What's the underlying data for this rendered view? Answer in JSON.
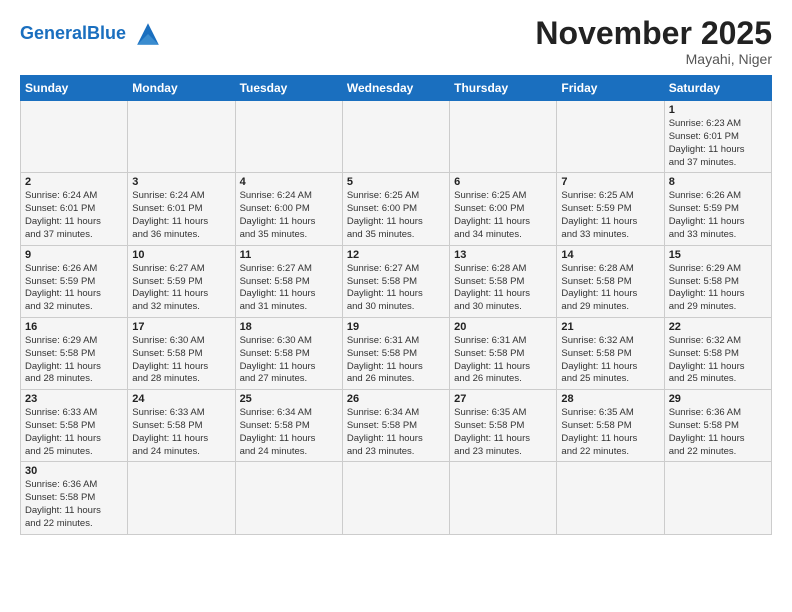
{
  "header": {
    "logo_general": "General",
    "logo_blue": "Blue",
    "month_title": "November 2025",
    "location": "Mayahi, Niger"
  },
  "weekdays": [
    "Sunday",
    "Monday",
    "Tuesday",
    "Wednesday",
    "Thursday",
    "Friday",
    "Saturday"
  ],
  "days": [
    {
      "num": "",
      "info": ""
    },
    {
      "num": "",
      "info": ""
    },
    {
      "num": "",
      "info": ""
    },
    {
      "num": "",
      "info": ""
    },
    {
      "num": "",
      "info": ""
    },
    {
      "num": "",
      "info": ""
    },
    {
      "num": "1",
      "info": "Sunrise: 6:23 AM\nSunset: 6:01 PM\nDaylight: 11 hours\nand 37 minutes."
    },
    {
      "num": "2",
      "info": "Sunrise: 6:24 AM\nSunset: 6:01 PM\nDaylight: 11 hours\nand 37 minutes."
    },
    {
      "num": "3",
      "info": "Sunrise: 6:24 AM\nSunset: 6:01 PM\nDaylight: 11 hours\nand 36 minutes."
    },
    {
      "num": "4",
      "info": "Sunrise: 6:24 AM\nSunset: 6:00 PM\nDaylight: 11 hours\nand 35 minutes."
    },
    {
      "num": "5",
      "info": "Sunrise: 6:25 AM\nSunset: 6:00 PM\nDaylight: 11 hours\nand 35 minutes."
    },
    {
      "num": "6",
      "info": "Sunrise: 6:25 AM\nSunset: 6:00 PM\nDaylight: 11 hours\nand 34 minutes."
    },
    {
      "num": "7",
      "info": "Sunrise: 6:25 AM\nSunset: 5:59 PM\nDaylight: 11 hours\nand 33 minutes."
    },
    {
      "num": "8",
      "info": "Sunrise: 6:26 AM\nSunset: 5:59 PM\nDaylight: 11 hours\nand 33 minutes."
    },
    {
      "num": "9",
      "info": "Sunrise: 6:26 AM\nSunset: 5:59 PM\nDaylight: 11 hours\nand 32 minutes."
    },
    {
      "num": "10",
      "info": "Sunrise: 6:27 AM\nSunset: 5:59 PM\nDaylight: 11 hours\nand 32 minutes."
    },
    {
      "num": "11",
      "info": "Sunrise: 6:27 AM\nSunset: 5:58 PM\nDaylight: 11 hours\nand 31 minutes."
    },
    {
      "num": "12",
      "info": "Sunrise: 6:27 AM\nSunset: 5:58 PM\nDaylight: 11 hours\nand 30 minutes."
    },
    {
      "num": "13",
      "info": "Sunrise: 6:28 AM\nSunset: 5:58 PM\nDaylight: 11 hours\nand 30 minutes."
    },
    {
      "num": "14",
      "info": "Sunrise: 6:28 AM\nSunset: 5:58 PM\nDaylight: 11 hours\nand 29 minutes."
    },
    {
      "num": "15",
      "info": "Sunrise: 6:29 AM\nSunset: 5:58 PM\nDaylight: 11 hours\nand 29 minutes."
    },
    {
      "num": "16",
      "info": "Sunrise: 6:29 AM\nSunset: 5:58 PM\nDaylight: 11 hours\nand 28 minutes."
    },
    {
      "num": "17",
      "info": "Sunrise: 6:30 AM\nSunset: 5:58 PM\nDaylight: 11 hours\nand 28 minutes."
    },
    {
      "num": "18",
      "info": "Sunrise: 6:30 AM\nSunset: 5:58 PM\nDaylight: 11 hours\nand 27 minutes."
    },
    {
      "num": "19",
      "info": "Sunrise: 6:31 AM\nSunset: 5:58 PM\nDaylight: 11 hours\nand 26 minutes."
    },
    {
      "num": "20",
      "info": "Sunrise: 6:31 AM\nSunset: 5:58 PM\nDaylight: 11 hours\nand 26 minutes."
    },
    {
      "num": "21",
      "info": "Sunrise: 6:32 AM\nSunset: 5:58 PM\nDaylight: 11 hours\nand 25 minutes."
    },
    {
      "num": "22",
      "info": "Sunrise: 6:32 AM\nSunset: 5:58 PM\nDaylight: 11 hours\nand 25 minutes."
    },
    {
      "num": "23",
      "info": "Sunrise: 6:33 AM\nSunset: 5:58 PM\nDaylight: 11 hours\nand 25 minutes."
    },
    {
      "num": "24",
      "info": "Sunrise: 6:33 AM\nSunset: 5:58 PM\nDaylight: 11 hours\nand 24 minutes."
    },
    {
      "num": "25",
      "info": "Sunrise: 6:34 AM\nSunset: 5:58 PM\nDaylight: 11 hours\nand 24 minutes."
    },
    {
      "num": "26",
      "info": "Sunrise: 6:34 AM\nSunset: 5:58 PM\nDaylight: 11 hours\nand 23 minutes."
    },
    {
      "num": "27",
      "info": "Sunrise: 6:35 AM\nSunset: 5:58 PM\nDaylight: 11 hours\nand 23 minutes."
    },
    {
      "num": "28",
      "info": "Sunrise: 6:35 AM\nSunset: 5:58 PM\nDaylight: 11 hours\nand 22 minutes."
    },
    {
      "num": "29",
      "info": "Sunrise: 6:36 AM\nSunset: 5:58 PM\nDaylight: 11 hours\nand 22 minutes."
    },
    {
      "num": "30",
      "info": "Sunrise: 6:36 AM\nSunset: 5:58 PM\nDaylight: 11 hours\nand 22 minutes."
    },
    {
      "num": "",
      "info": ""
    },
    {
      "num": "",
      "info": ""
    },
    {
      "num": "",
      "info": ""
    },
    {
      "num": "",
      "info": ""
    },
    {
      "num": "",
      "info": ""
    },
    {
      "num": "",
      "info": ""
    }
  ]
}
